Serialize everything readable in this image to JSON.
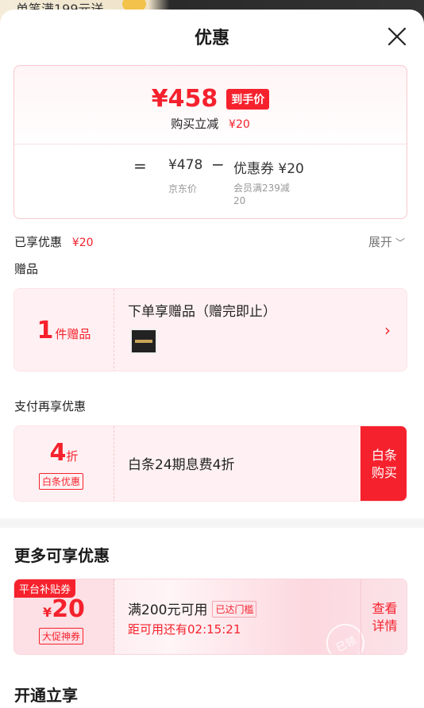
{
  "background": {
    "peek_text": "单笔满199元送"
  },
  "sheet": {
    "title": "优惠"
  },
  "price_card": {
    "final_price": "¥458",
    "final_tag": "到手价",
    "instant_label": "购买立减",
    "instant_amount": "¥20",
    "equals": "=",
    "jd_price": "¥478",
    "jd_label": "京东价",
    "minus": "−",
    "coupon_price": "优惠券 ¥20",
    "coupon_label": "会员满239减20"
  },
  "enjoyed": {
    "label": "已享优惠",
    "amount": "¥20",
    "expand_label": "展开"
  },
  "gift": {
    "section_label": "赠品",
    "count": "1",
    "unit": "件赠品",
    "title": "下单享赠品（赠完即止）"
  },
  "payment": {
    "section_label": "支付再享优惠",
    "discount_num": "4",
    "discount_unit": "折",
    "tag": "白条优惠",
    "title": "白条24期息费4折",
    "buy_label": "白条购买"
  },
  "more": {
    "title": "更多可享优惠",
    "badge": "平台补贴券",
    "currency": "¥",
    "amount": "20",
    "sub_tag": "大促神券",
    "condition": "满200元可用",
    "reached": "已达门槛",
    "timer": "距可用还有02:15:21",
    "view_label": "查看详情",
    "stamp": "已领"
  },
  "open": {
    "title": "开通立享"
  },
  "colors": {
    "accent": "#f5222d",
    "card_bg": "#fff1f3"
  }
}
